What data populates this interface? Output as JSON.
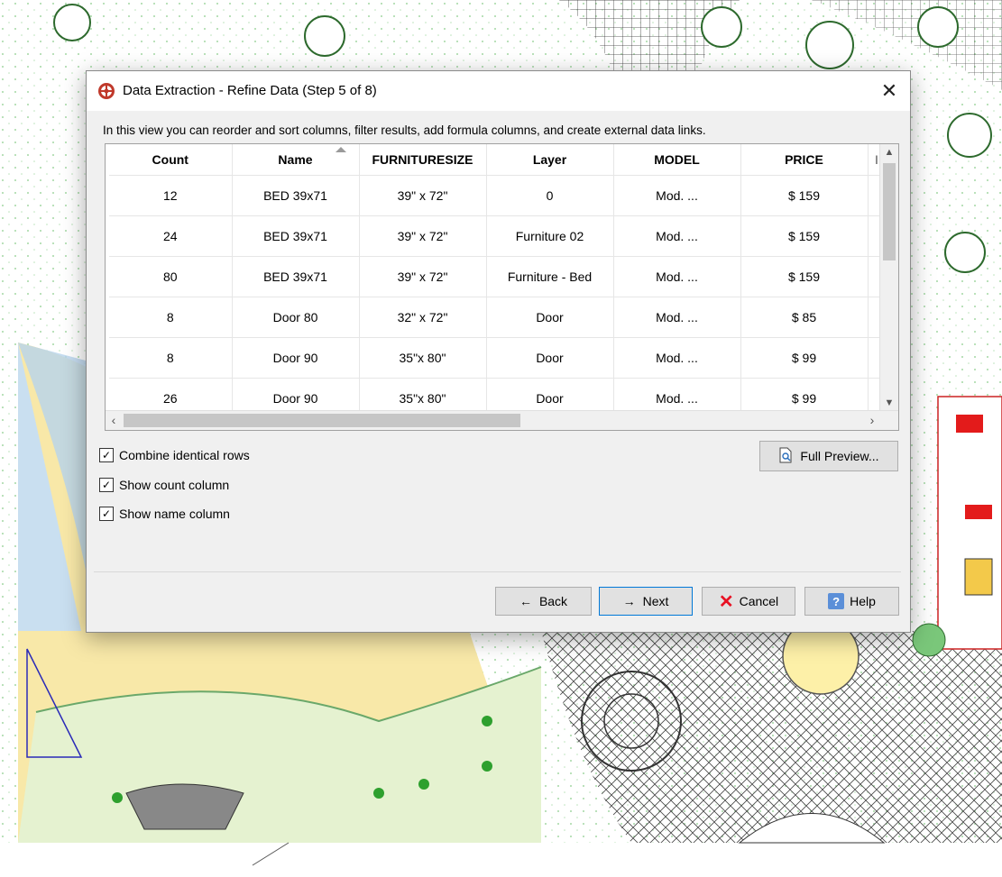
{
  "dialog": {
    "title": "Data Extraction - Refine Data (Step 5 of 8)",
    "close_glyph": "✕",
    "intro": "In this view you can reorder and sort columns, filter results, add formula columns, and create external data links."
  },
  "table": {
    "headers": [
      "Count",
      "Name",
      "FURNITURESIZE",
      "Layer",
      "MODEL",
      "PRICE",
      "I"
    ],
    "rows": [
      [
        "12",
        "BED 39x71",
        "39\" x 72\"",
        "0",
        "Mod. ...",
        "$ 159",
        ""
      ],
      [
        "24",
        "BED 39x71",
        "39\" x 72\"",
        "Furniture 02",
        "Mod. ...",
        "$ 159",
        ""
      ],
      [
        "80",
        "BED 39x71",
        "39\" x 72\"",
        "Furniture - Bed",
        "Mod. ...",
        "$ 159",
        ""
      ],
      [
        "8",
        "Door 80",
        "32\" x 72\"",
        "Door",
        "Mod. ...",
        "$ 85",
        ""
      ],
      [
        "8",
        "Door 90",
        "35\"x 80\"",
        "Door",
        "Mod. ...",
        "$ 99",
        ""
      ],
      [
        "26",
        "Door 90",
        "35\"x 80\"",
        "Door",
        "Mod. ...",
        "$ 99",
        ""
      ]
    ],
    "sorted_column": "Name"
  },
  "options": {
    "combine_identical_rows": {
      "label": "Combine identical rows",
      "checked": true
    },
    "show_count_column": {
      "label": "Show count column",
      "checked": true
    },
    "show_name_column": {
      "label": "Show name column",
      "checked": true
    }
  },
  "buttons": {
    "full_preview": "Full Preview...",
    "back": "Back",
    "next": "Next",
    "cancel": "Cancel",
    "help": "Help"
  },
  "colors": {
    "accent": "#0078d7",
    "cancel_red": "#e81123",
    "help_blue": "#5b8fd8"
  }
}
